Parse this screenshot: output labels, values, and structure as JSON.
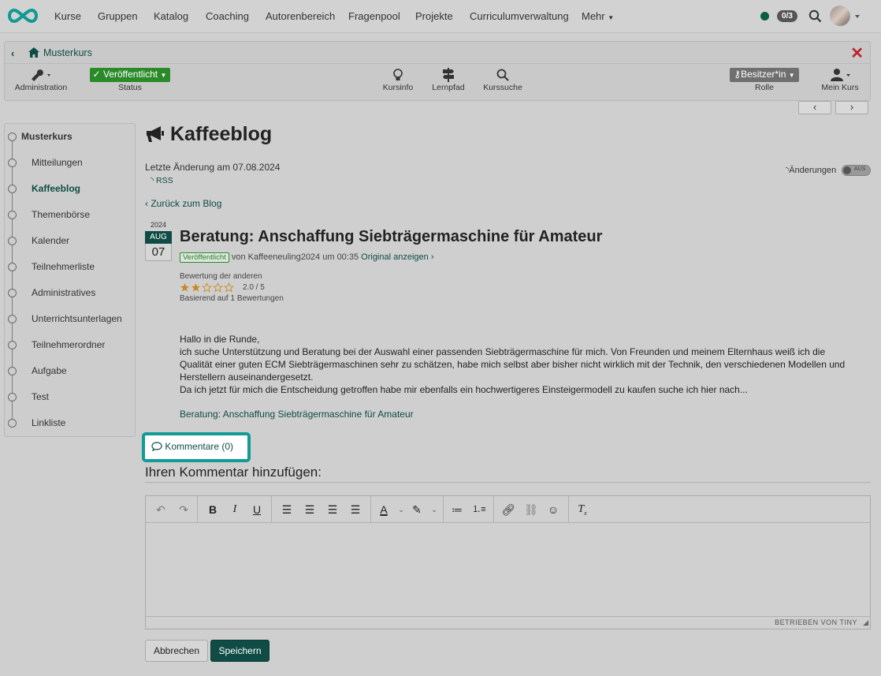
{
  "topnav": {
    "items": [
      "Kurse",
      "Gruppen",
      "Katalog",
      "Coaching",
      "Autorenbereich",
      "Fragenpool",
      "Projekte",
      "Curriculumverwaltung",
      "Mehr"
    ],
    "count_badge": "0/3",
    "status_color": "#0c5e3f"
  },
  "course": {
    "breadcrumb": "Musterkurs",
    "tools": {
      "administration": "Administration",
      "status_value": "Veröffentlicht",
      "status_label": "Status",
      "kursinfo": "Kursinfo",
      "lernpfad": "Lernpfad",
      "kurssuche": "Kurssuche",
      "role_value": "Besitzer*in",
      "role_label": "Rolle",
      "mein_kurs": "Mein Kurs"
    }
  },
  "sidebar": {
    "root": "Musterkurs",
    "items": [
      "Mitteilungen",
      "Kaffeeblog",
      "Themenbörse",
      "Kalender",
      "Teilnehmerliste",
      "Administratives",
      "Unterrichtsunterlagen",
      "Teilnehmerordner",
      "Aufgabe",
      "Test",
      "Linkliste"
    ],
    "active": "Kaffeeblog"
  },
  "blog": {
    "title": "Kaffeeblog",
    "last_change": "Letzte Änderung am 07.08.2024",
    "rss": "RSS",
    "changes_label": "Änderungen",
    "toggle_state": "AUS",
    "back_link": "Zurück zum Blog"
  },
  "post": {
    "date": {
      "year": "2024",
      "month": "AUG",
      "day": "07"
    },
    "title": "Beratung: Anschaffung Siebträgermaschine für Amateur",
    "status_tag": "Veröffentlicht",
    "meta": "von Kaffeeneuling2024 um 00:35",
    "original_link": "Original anzeigen",
    "rating_label": "Bewertung der anderen",
    "rating_value": "2.0 / 5",
    "rating_stars": 2.0,
    "rating_max": 5,
    "rating_base": "Basierend auf 1 Bewertungen",
    "body": [
      "Hallo in die Runde,",
      "ich suche Unterstützung und Beratung bei der Auswahl einer passenden Siebträgermaschine für mich. Von Freunden und meinem Elternhaus weiß ich die Qualität einer guten ECM Siebträgermaschinen sehr zu schätzen, habe mich selbst aber bisher nicht wirklich mit der Technik, den verschiedenen Modellen und Herstellern auseinandergesetzt.",
      "Da ich jetzt für mich die Entscheidung getroffen habe mir ebenfalls ein hochwertigeres Einsteigermodell zu kaufen suche ich hier nach..."
    ],
    "link_text": "Beratung: Anschaffung Siebträgermaschine für Amateur"
  },
  "comments": {
    "button_label": "Kommentare (0)",
    "add_heading": "Ihren Kommentar hinzufügen:",
    "powered_by": "BETRIEBEN VON TINY",
    "cancel": "Abbrechen",
    "save": "Speichern"
  }
}
